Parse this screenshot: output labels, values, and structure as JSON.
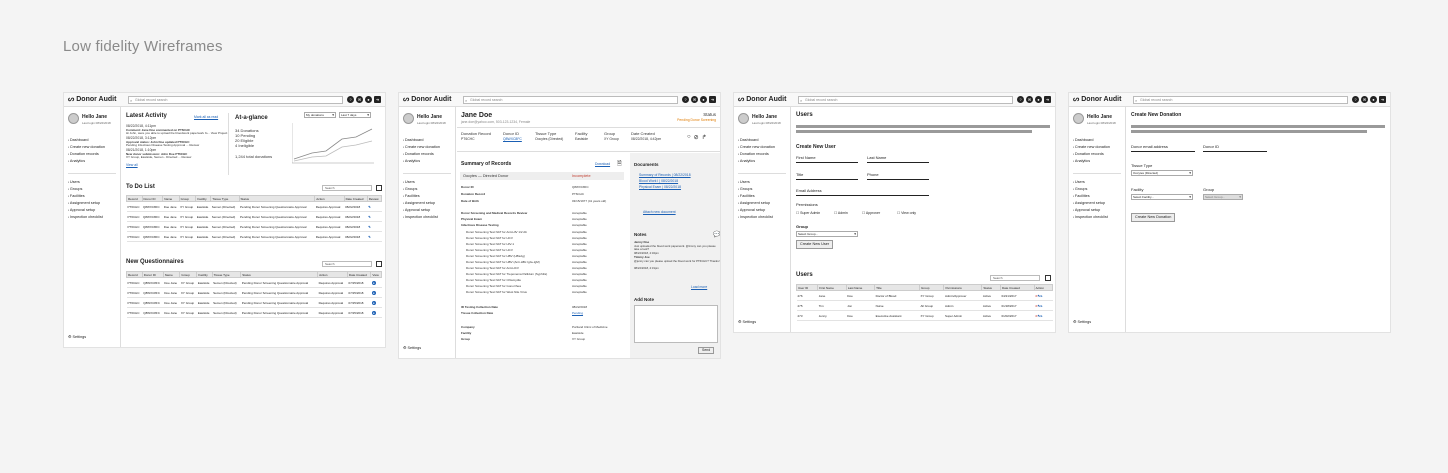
{
  "page_title": "Low fidelity Wireframes",
  "common": {
    "app_name": "Donor Audit",
    "search_placeholder": "Global record search",
    "hello": "Hello Jane",
    "last_login": "Last login 08/22/2018",
    "nav": [
      "Dashboard",
      "Create new donation",
      "Donation records",
      "Analytics"
    ],
    "admin": [
      "Users",
      "Groups",
      "Facilities",
      "Assignment setup",
      "Approval setup",
      "Inspection checklist"
    ],
    "settings": "Settings",
    "topbar_icons": [
      "help-icon",
      "mail-icon",
      "user-icon",
      "logout-icon"
    ]
  },
  "dashboard": {
    "latest_activity": "Latest Activity",
    "mark_all_read": "Mark all as read",
    "activity": [
      {
        "date": "08/22/2018, 4:11pm",
        "title": "Comment: Jane Doe commented on PT6CHC",
        "body": "Hi John, were you able to upload the bloodwork paperwork fo... View Project"
      },
      {
        "date": "08/22/2018, 3:12pm",
        "title": "Approval status: John Doe updated PT6CHC",
        "body": "Pending Infectious Disease Testing Approval ... Review"
      },
      {
        "date": "08/21/2018, 1:10pm",
        "title": "New donor submission: John Doe PT6CHC",
        "body": "XY Group, Eastside, Semen - Directed ... Review"
      }
    ],
    "view_all": "View all",
    "at_a_glance": "At-a-glance",
    "metric_select": "My donations",
    "range_select": "Last 7 days",
    "stats": [
      "34 Donations",
      "10 Pending",
      "20 Eligible",
      "4 Ineligible"
    ],
    "total": "1,244 total donations",
    "todo_title": "To Do List",
    "todo_search": "Search",
    "todo_headers": [
      "Record",
      "Donor ID",
      "Name",
      "Group",
      "Facility",
      "Tissue Type",
      "Status",
      "Action",
      "Date Created",
      "Review"
    ],
    "todo_rows": [
      [
        "PT6CHC",
        "Q8WXC8FC",
        "Doe Jane",
        "XY Group",
        "Eastside",
        "Semen (Directed)",
        "Pending Donor Screening Questionnaire Approval",
        "Requires Approval",
        "08/22/2018"
      ],
      [
        "PT6CHC",
        "Q8WXC8FC",
        "Doe Jane",
        "XY Group",
        "Eastside",
        "Semen (Directed)",
        "Pending Donor Screening Questionnaire Approval",
        "Requires Approval",
        "08/22/2018"
      ],
      [
        "PT6CHC",
        "Q8WXC8FC",
        "Doe Jane",
        "XY Group",
        "Eastside",
        "Semen (Directed)",
        "Pending Donor Screening Questionnaire Approval",
        "Requires Approval",
        "08/22/2018"
      ],
      [
        "PT6CHC",
        "Q8WXC8FC",
        "Doe Jane",
        "XY Group",
        "Eastside",
        "Semen (Directed)",
        "Pending Donor Screening Questionnaire Approval",
        "Requires Approval",
        "08/22/2018"
      ]
    ],
    "nq_title": "New Questionnaires",
    "nq_search": "Search",
    "nq_headers": [
      "Record",
      "Donor ID",
      "Name",
      "Group",
      "Facility",
      "Tissue Type",
      "Status",
      "Action",
      "Date Created",
      "View"
    ],
    "nq_rows": [
      [
        "PT6CHC",
        "Q8WXC8FC",
        "Doe Jane",
        "XY Group",
        "Eastside",
        "Semen (Directed)",
        "Pending Donor Screening Questionnaire Approval",
        "Requires Approval",
        "07/25/2018"
      ],
      [
        "PT6CHC",
        "Q8WXC8FC",
        "Doe Jane",
        "XY Group",
        "Eastside",
        "Semen (Directed)",
        "Pending Donor Screening Questionnaire Approval",
        "Requires Approval",
        "07/25/2018"
      ],
      [
        "PT6CHC",
        "Q8WXC8FC",
        "Doe Jane",
        "XY Group",
        "Eastside",
        "Semen (Directed)",
        "Pending Donor Screening Questionnaire Approval",
        "Requires Approval",
        "07/25/2018"
      ],
      [
        "PT6CHC",
        "Q8WXC8FC",
        "Doe Jane",
        "XY Group",
        "Eastside",
        "Semen (Directed)",
        "Pending Donor Screening Questionnaire Approval",
        "Requires Approval",
        "07/25/2018"
      ]
    ]
  },
  "record": {
    "name": "Jane Doe",
    "contact": "jane.doe@yahoo.com, 503-123-1234, Female",
    "status_label": "Status",
    "status_value": "Pending Donor Screening",
    "meta_labels": [
      "Donation Record",
      "Donor ID",
      "Tissue Type",
      "Facility",
      "Group",
      "Date Created"
    ],
    "meta_values": [
      "PT6CHC",
      "Q8WXC8FC",
      "Oocytes (Directed)",
      "Eastside",
      "XY Group",
      "08/22/2018, 4:42pm"
    ],
    "summary_title": "Summary of Records",
    "download": "Download",
    "doc_type": "Oocytes — Directed Donor",
    "doc_status": "Incomplete",
    "rows": [
      [
        "Donor ID",
        "Q8WXC8FC"
      ],
      [
        "Donation Record",
        "PT6CHC"
      ],
      [
        "Date of Birth",
        "03/15/1977 (41 years old)"
      ],
      [
        "Donor Screening and Medical Records Review",
        "Acceptable"
      ],
      [
        "Physical Exam",
        "Acceptable"
      ],
      [
        "Infectious Disease Testing",
        "Acceptable"
      ],
      [
        "Donor Screening Test NAT for Anti-HIV 1/2 Ab",
        "Acceptable"
      ],
      [
        "Donor Screening Test NAT for HCV",
        "Acceptable"
      ],
      [
        "Donor Screening Test NAT for HIV-1",
        "Acceptable"
      ],
      [
        "Donor Screening Test NAT for HCV",
        "Acceptable"
      ],
      [
        "Donor Screening Test NAT for HBV (HBsAg)",
        "Acceptable"
      ],
      [
        "Donor Screening Test NAT for HBV (Anti-HBc IgG+IgM)",
        "Acceptable"
      ],
      [
        "Donor Screening Test NAT for Anti-HCV",
        "Acceptable"
      ],
      [
        "Donor Screening Test NAT for Treponema Pallidum (Syphilis)",
        "Acceptable"
      ],
      [
        "Donor Screening Test NAT for Chlamydia",
        "Acceptable"
      ],
      [
        "Donor Screening Test NAT for Gonorrhea",
        "Acceptable"
      ],
      [
        "Donor Screening Test NAT for West Nile Virus",
        "Acceptable"
      ],
      [
        "ID Testing Collection Date",
        "08/22/2018"
      ],
      [
        "Tissue Collection Date",
        "Pending"
      ],
      [
        "Company",
        "Portland Clinic of Medicine"
      ],
      [
        "Facility",
        "Eastside"
      ],
      [
        "Group",
        "XY Group"
      ]
    ],
    "documents_title": "Documents",
    "documents": [
      "Summary of Records | 08/22/2018",
      "Blood Work I | 08/22/2018",
      "Physical Exam | 08/22/2018"
    ],
    "attach": "Attach new document",
    "notes_title": "Notes",
    "notes": [
      {
        "author": "Jenny Doe",
        "body": "Just uploaded the blood work paperwork. @timmy can you please take a look?",
        "date": "08/22/2018, 4:32pm"
      },
      {
        "author": "Timmy Joe",
        "body": "@jenny can you please upload the blood work for PT6CHC? Thanks!",
        "date": "08/22/2018, 4:31pm"
      }
    ],
    "load_more": "Load more",
    "add_note": "Add Note",
    "send": "Send"
  },
  "users": {
    "title": "Users",
    "create_title": "Create New User",
    "labels": {
      "first": "First Name",
      "last": "Last Name",
      "title": "Title",
      "phone": "Phone",
      "email": "Email Address",
      "permissions": "Permissions",
      "group": "Group"
    },
    "perm_options": [
      "Super Admin",
      "Admin",
      "Approver",
      "View only"
    ],
    "group_select": "Select Group...",
    "create_btn": "Create New User",
    "list_title": "Users",
    "search": "Search",
    "headers": [
      "User ID",
      "First Name",
      "Last Name",
      "Title",
      "Group",
      "Permissions",
      "Status",
      "Date Created",
      "Action"
    ],
    "rows": [
      [
        "276",
        "Jane",
        "Doe",
        "Doctor of Blood",
        "XY Group",
        "Admin/Approver",
        "Active",
        "04/21/2017"
      ],
      [
        "275",
        "Tim",
        "Jon",
        "Nurse",
        "All Group",
        "Admin",
        "Active",
        "01/18/2017"
      ],
      [
        "273",
        "Jenny",
        "Doe",
        "Executive Assistant",
        "XY Group",
        "Super Admin",
        "Active",
        "01/02/2017"
      ]
    ]
  },
  "create": {
    "title": "Create New Donation",
    "donor_email": "Donor email address",
    "donor_id": "Donor ID",
    "tissue_type": "Tissue Type",
    "tissue_value": "Oocytes (Directed)",
    "facility": "Facility",
    "facility_value": "Select Facility...",
    "group": "Group",
    "group_value": "Select Group...",
    "btn": "Create New Donation"
  }
}
